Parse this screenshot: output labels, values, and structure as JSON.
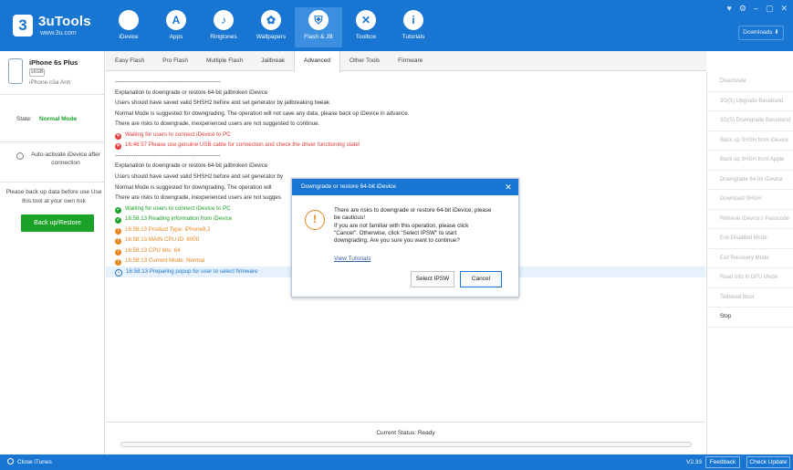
{
  "app": {
    "name": "3uTools",
    "url": "www.3u.com",
    "logo_glyph": "3"
  },
  "nav": [
    {
      "label": "iDevice",
      "icon": "apple-icon",
      "glyph": ""
    },
    {
      "label": "Apps",
      "icon": "apps-store-icon",
      "glyph": "A"
    },
    {
      "label": "Ringtones",
      "icon": "bell-icon",
      "glyph": "♪"
    },
    {
      "label": "Wallpapers",
      "icon": "flower-icon",
      "glyph": "✿"
    },
    {
      "label": "Flash & JB",
      "icon": "shield-flash-icon",
      "glyph": "⛨"
    },
    {
      "label": "Toolbox",
      "icon": "tools-icon",
      "glyph": "✕"
    },
    {
      "label": "Tutorials",
      "icon": "info-icon",
      "glyph": "i"
    }
  ],
  "window": {
    "controls": [
      "♥",
      "⚙",
      "–",
      "▢",
      "✕"
    ],
    "downloads_label": "Downloads ⬇"
  },
  "device": {
    "name": "iPhone 6s Plus",
    "capacity": "16GB",
    "owner": "iPhone của Anh"
  },
  "state": {
    "label": "State:",
    "value": "Normal Mode"
  },
  "auto_activate": "Auto-activate iDevice after connection",
  "backup": {
    "note": "Please back up data before use Use this tool at your own risk",
    "button": "Back up/Restore"
  },
  "tabs": [
    "Easy Flash",
    "Pro Flash",
    "Multiple Flash",
    "Jailbreak",
    "Advanced",
    "Other Tools",
    "Firmware"
  ],
  "active_tab": "Advanced",
  "log": [
    {
      "text": "--------------------------------------------------------",
      "type": "plain"
    },
    {
      "text": "Explanation to downgrade or restore 64-bit jailbroken iDevice",
      "type": "plain"
    },
    {
      "text": "Users should have saved valid SHSH2 before and set generator by jailbreaking tweak",
      "type": "plain"
    },
    {
      "text": "Normal Mode is suggested for downgrading. The operation will not save any data, please back up iDevice in advance.",
      "type": "plain"
    },
    {
      "text": "There are risks to downgrade, inexperienced users are not suggested to continue.",
      "type": "plain"
    },
    {
      "text": "Waiting for users to connect iDevice to PC",
      "type": "red",
      "icon": "error-icon",
      "glyph": "✕"
    },
    {
      "text": "16:46:57   Please use genuine USB cable for connection and check the driver functioning state!",
      "type": "red",
      "icon": "error-icon",
      "glyph": "✕"
    },
    {
      "text": "--------------------------------------------------------",
      "type": "plain"
    },
    {
      "text": "Explanation to downgrade or restore 64-bit jailbroken iDevice",
      "type": "plain"
    },
    {
      "text": "Users should have saved valid SHSH2 before and set generator by",
      "type": "plain"
    },
    {
      "text": "Normal Mode is suggested for downgrading. The operation will",
      "type": "plain"
    },
    {
      "text": "There are risks to downgrade, inexperienced users are not sugges",
      "type": "plain"
    },
    {
      "text": "Waiting for users to connect iDevice to PC",
      "type": "green",
      "icon": "check-icon",
      "glyph": "✓"
    },
    {
      "text": "16:58:13   Reading information from iDevice",
      "type": "green",
      "icon": "check-icon",
      "glyph": "✓"
    },
    {
      "text": "16:58:13   Product Type: iPhone8,2",
      "type": "orange",
      "icon": "warning-dot-icon",
      "glyph": "!"
    },
    {
      "text": "16:58:13   MAIN CPU ID: 8000",
      "type": "orange",
      "icon": "warning-dot-icon",
      "glyph": "!"
    },
    {
      "text": "16:58:13   CPU bits: 64",
      "type": "orange",
      "icon": "warning-dot-icon",
      "glyph": "!"
    },
    {
      "text": "16:58:13   Current Mode: Normal",
      "type": "orange",
      "icon": "warning-dot-icon",
      "glyph": "!"
    },
    {
      "text": "16:58:13   Preparing popup for user to select firmware",
      "type": "blue",
      "icon": "progress-icon",
      "glyph": "•",
      "highlight": true
    }
  ],
  "status": {
    "text": "Current Status: Ready",
    "progress": 0
  },
  "right_actions": [
    {
      "label": "Deactivate",
      "enabled": false
    },
    {
      "label": "3G(S) Upgrade Baseband",
      "enabled": false
    },
    {
      "label": "3G(S) Downgrade Baseband",
      "enabled": false
    },
    {
      "label": "Back up SHSH from iDevice",
      "enabled": false
    },
    {
      "label": "Back up SHSH from Apple",
      "enabled": false
    },
    {
      "label": "Downgrade 64-bit iDevice",
      "enabled": false
    },
    {
      "label": "Download SHSH",
      "enabled": false
    },
    {
      "label": "Retrieve iDevice's Passcode",
      "enabled": false
    },
    {
      "label": "Exit Disabled Mode",
      "enabled": false
    },
    {
      "label": "Exit Recovery Mode",
      "enabled": false
    },
    {
      "label": "Read Info in DFU Mode",
      "enabled": false
    },
    {
      "label": "Tethered Boot",
      "enabled": false
    },
    {
      "label": "Stop",
      "enabled": true
    }
  ],
  "dialog": {
    "title": "Downgrade or restore 64-bit iDevice",
    "close": "✕",
    "warning_glyph": "!",
    "message": [
      "There are risks to downgrade or restore 64-bit iDevice, please",
      "be cautious!",
      "If you are not familiar with this operation, please click",
      "\"Cancel\". Otherwise, click \"Select IPSW\" to start",
      "downgrading. Are you sure you want to continue?"
    ],
    "link": "View Tutorials",
    "select_button": "Select IPSW",
    "cancel_button": "Cancel"
  },
  "footer": {
    "itunes": "Close iTunes",
    "version": "V2.33",
    "feedback": "Feedback",
    "check_update": "Check Update"
  },
  "colors": {
    "brand": "#1875d1",
    "success": "#1aa128",
    "error": "#e23b3b",
    "warning": "#e8851d"
  }
}
